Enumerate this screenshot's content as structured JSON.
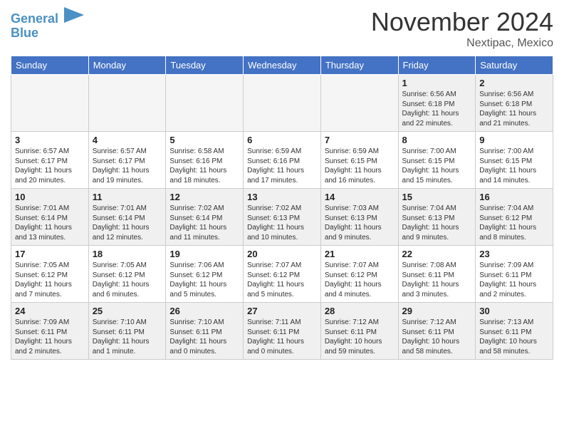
{
  "header": {
    "logo_line1": "General",
    "logo_line2": "Blue",
    "month_title": "November 2024",
    "location": "Nextipac, Mexico"
  },
  "days_of_week": [
    "Sunday",
    "Monday",
    "Tuesday",
    "Wednesday",
    "Thursday",
    "Friday",
    "Saturday"
  ],
  "weeks": [
    {
      "days": [
        {
          "num": "",
          "info": "",
          "empty": true
        },
        {
          "num": "",
          "info": "",
          "empty": true
        },
        {
          "num": "",
          "info": "",
          "empty": true
        },
        {
          "num": "",
          "info": "",
          "empty": true
        },
        {
          "num": "",
          "info": "",
          "empty": true
        },
        {
          "num": "1",
          "info": "Sunrise: 6:56 AM\nSunset: 6:18 PM\nDaylight: 11 hours\nand 22 minutes.",
          "empty": false
        },
        {
          "num": "2",
          "info": "Sunrise: 6:56 AM\nSunset: 6:18 PM\nDaylight: 11 hours\nand 21 minutes.",
          "empty": false
        }
      ]
    },
    {
      "days": [
        {
          "num": "3",
          "info": "Sunrise: 6:57 AM\nSunset: 6:17 PM\nDaylight: 11 hours\nand 20 minutes.",
          "empty": false
        },
        {
          "num": "4",
          "info": "Sunrise: 6:57 AM\nSunset: 6:17 PM\nDaylight: 11 hours\nand 19 minutes.",
          "empty": false
        },
        {
          "num": "5",
          "info": "Sunrise: 6:58 AM\nSunset: 6:16 PM\nDaylight: 11 hours\nand 18 minutes.",
          "empty": false
        },
        {
          "num": "6",
          "info": "Sunrise: 6:59 AM\nSunset: 6:16 PM\nDaylight: 11 hours\nand 17 minutes.",
          "empty": false
        },
        {
          "num": "7",
          "info": "Sunrise: 6:59 AM\nSunset: 6:15 PM\nDaylight: 11 hours\nand 16 minutes.",
          "empty": false
        },
        {
          "num": "8",
          "info": "Sunrise: 7:00 AM\nSunset: 6:15 PM\nDaylight: 11 hours\nand 15 minutes.",
          "empty": false
        },
        {
          "num": "9",
          "info": "Sunrise: 7:00 AM\nSunset: 6:15 PM\nDaylight: 11 hours\nand 14 minutes.",
          "empty": false
        }
      ]
    },
    {
      "days": [
        {
          "num": "10",
          "info": "Sunrise: 7:01 AM\nSunset: 6:14 PM\nDaylight: 11 hours\nand 13 minutes.",
          "empty": false
        },
        {
          "num": "11",
          "info": "Sunrise: 7:01 AM\nSunset: 6:14 PM\nDaylight: 11 hours\nand 12 minutes.",
          "empty": false
        },
        {
          "num": "12",
          "info": "Sunrise: 7:02 AM\nSunset: 6:14 PM\nDaylight: 11 hours\nand 11 minutes.",
          "empty": false
        },
        {
          "num": "13",
          "info": "Sunrise: 7:02 AM\nSunset: 6:13 PM\nDaylight: 11 hours\nand 10 minutes.",
          "empty": false
        },
        {
          "num": "14",
          "info": "Sunrise: 7:03 AM\nSunset: 6:13 PM\nDaylight: 11 hours\nand 9 minutes.",
          "empty": false
        },
        {
          "num": "15",
          "info": "Sunrise: 7:04 AM\nSunset: 6:13 PM\nDaylight: 11 hours\nand 9 minutes.",
          "empty": false
        },
        {
          "num": "16",
          "info": "Sunrise: 7:04 AM\nSunset: 6:12 PM\nDaylight: 11 hours\nand 8 minutes.",
          "empty": false
        }
      ]
    },
    {
      "days": [
        {
          "num": "17",
          "info": "Sunrise: 7:05 AM\nSunset: 6:12 PM\nDaylight: 11 hours\nand 7 minutes.",
          "empty": false
        },
        {
          "num": "18",
          "info": "Sunrise: 7:05 AM\nSunset: 6:12 PM\nDaylight: 11 hours\nand 6 minutes.",
          "empty": false
        },
        {
          "num": "19",
          "info": "Sunrise: 7:06 AM\nSunset: 6:12 PM\nDaylight: 11 hours\nand 5 minutes.",
          "empty": false
        },
        {
          "num": "20",
          "info": "Sunrise: 7:07 AM\nSunset: 6:12 PM\nDaylight: 11 hours\nand 5 minutes.",
          "empty": false
        },
        {
          "num": "21",
          "info": "Sunrise: 7:07 AM\nSunset: 6:12 PM\nDaylight: 11 hours\nand 4 minutes.",
          "empty": false
        },
        {
          "num": "22",
          "info": "Sunrise: 7:08 AM\nSunset: 6:11 PM\nDaylight: 11 hours\nand 3 minutes.",
          "empty": false
        },
        {
          "num": "23",
          "info": "Sunrise: 7:09 AM\nSunset: 6:11 PM\nDaylight: 11 hours\nand 2 minutes.",
          "empty": false
        }
      ]
    },
    {
      "days": [
        {
          "num": "24",
          "info": "Sunrise: 7:09 AM\nSunset: 6:11 PM\nDaylight: 11 hours\nand 2 minutes.",
          "empty": false
        },
        {
          "num": "25",
          "info": "Sunrise: 7:10 AM\nSunset: 6:11 PM\nDaylight: 11 hours\nand 1 minute.",
          "empty": false
        },
        {
          "num": "26",
          "info": "Sunrise: 7:10 AM\nSunset: 6:11 PM\nDaylight: 11 hours\nand 0 minutes.",
          "empty": false
        },
        {
          "num": "27",
          "info": "Sunrise: 7:11 AM\nSunset: 6:11 PM\nDaylight: 11 hours\nand 0 minutes.",
          "empty": false
        },
        {
          "num": "28",
          "info": "Sunrise: 7:12 AM\nSunset: 6:11 PM\nDaylight: 10 hours\nand 59 minutes.",
          "empty": false
        },
        {
          "num": "29",
          "info": "Sunrise: 7:12 AM\nSunset: 6:11 PM\nDaylight: 10 hours\nand 58 minutes.",
          "empty": false
        },
        {
          "num": "30",
          "info": "Sunrise: 7:13 AM\nSunset: 6:11 PM\nDaylight: 10 hours\nand 58 minutes.",
          "empty": false
        }
      ]
    }
  ]
}
